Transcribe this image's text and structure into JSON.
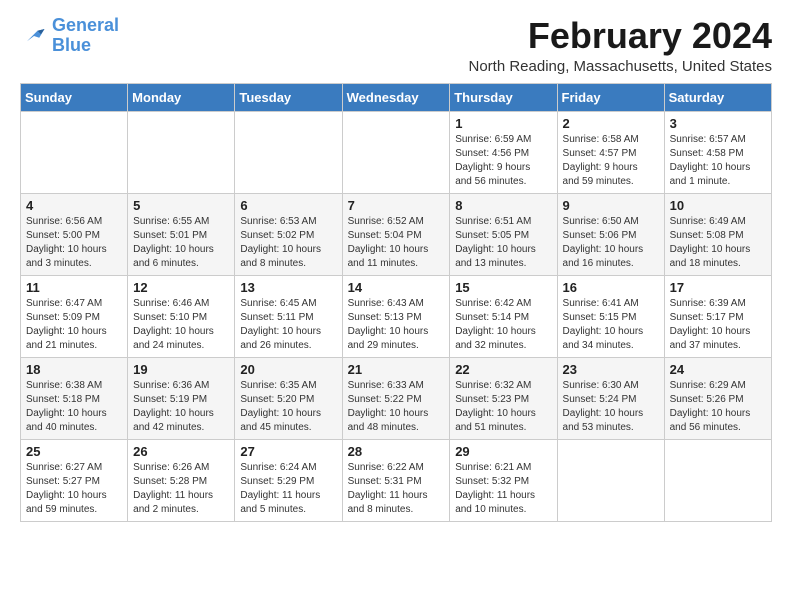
{
  "logo": {
    "line1": "General",
    "line2": "Blue"
  },
  "title": "February 2024",
  "location": "North Reading, Massachusetts, United States",
  "days_of_week": [
    "Sunday",
    "Monday",
    "Tuesday",
    "Wednesday",
    "Thursday",
    "Friday",
    "Saturday"
  ],
  "weeks": [
    [
      {
        "day": "",
        "info": ""
      },
      {
        "day": "",
        "info": ""
      },
      {
        "day": "",
        "info": ""
      },
      {
        "day": "",
        "info": ""
      },
      {
        "day": "1",
        "info": "Sunrise: 6:59 AM\nSunset: 4:56 PM\nDaylight: 9 hours\nand 56 minutes."
      },
      {
        "day": "2",
        "info": "Sunrise: 6:58 AM\nSunset: 4:57 PM\nDaylight: 9 hours\nand 59 minutes."
      },
      {
        "day": "3",
        "info": "Sunrise: 6:57 AM\nSunset: 4:58 PM\nDaylight: 10 hours\nand 1 minute."
      }
    ],
    [
      {
        "day": "4",
        "info": "Sunrise: 6:56 AM\nSunset: 5:00 PM\nDaylight: 10 hours\nand 3 minutes."
      },
      {
        "day": "5",
        "info": "Sunrise: 6:55 AM\nSunset: 5:01 PM\nDaylight: 10 hours\nand 6 minutes."
      },
      {
        "day": "6",
        "info": "Sunrise: 6:53 AM\nSunset: 5:02 PM\nDaylight: 10 hours\nand 8 minutes."
      },
      {
        "day": "7",
        "info": "Sunrise: 6:52 AM\nSunset: 5:04 PM\nDaylight: 10 hours\nand 11 minutes."
      },
      {
        "day": "8",
        "info": "Sunrise: 6:51 AM\nSunset: 5:05 PM\nDaylight: 10 hours\nand 13 minutes."
      },
      {
        "day": "9",
        "info": "Sunrise: 6:50 AM\nSunset: 5:06 PM\nDaylight: 10 hours\nand 16 minutes."
      },
      {
        "day": "10",
        "info": "Sunrise: 6:49 AM\nSunset: 5:08 PM\nDaylight: 10 hours\nand 18 minutes."
      }
    ],
    [
      {
        "day": "11",
        "info": "Sunrise: 6:47 AM\nSunset: 5:09 PM\nDaylight: 10 hours\nand 21 minutes."
      },
      {
        "day": "12",
        "info": "Sunrise: 6:46 AM\nSunset: 5:10 PM\nDaylight: 10 hours\nand 24 minutes."
      },
      {
        "day": "13",
        "info": "Sunrise: 6:45 AM\nSunset: 5:11 PM\nDaylight: 10 hours\nand 26 minutes."
      },
      {
        "day": "14",
        "info": "Sunrise: 6:43 AM\nSunset: 5:13 PM\nDaylight: 10 hours\nand 29 minutes."
      },
      {
        "day": "15",
        "info": "Sunrise: 6:42 AM\nSunset: 5:14 PM\nDaylight: 10 hours\nand 32 minutes."
      },
      {
        "day": "16",
        "info": "Sunrise: 6:41 AM\nSunset: 5:15 PM\nDaylight: 10 hours\nand 34 minutes."
      },
      {
        "day": "17",
        "info": "Sunrise: 6:39 AM\nSunset: 5:17 PM\nDaylight: 10 hours\nand 37 minutes."
      }
    ],
    [
      {
        "day": "18",
        "info": "Sunrise: 6:38 AM\nSunset: 5:18 PM\nDaylight: 10 hours\nand 40 minutes."
      },
      {
        "day": "19",
        "info": "Sunrise: 6:36 AM\nSunset: 5:19 PM\nDaylight: 10 hours\nand 42 minutes."
      },
      {
        "day": "20",
        "info": "Sunrise: 6:35 AM\nSunset: 5:20 PM\nDaylight: 10 hours\nand 45 minutes."
      },
      {
        "day": "21",
        "info": "Sunrise: 6:33 AM\nSunset: 5:22 PM\nDaylight: 10 hours\nand 48 minutes."
      },
      {
        "day": "22",
        "info": "Sunrise: 6:32 AM\nSunset: 5:23 PM\nDaylight: 10 hours\nand 51 minutes."
      },
      {
        "day": "23",
        "info": "Sunrise: 6:30 AM\nSunset: 5:24 PM\nDaylight: 10 hours\nand 53 minutes."
      },
      {
        "day": "24",
        "info": "Sunrise: 6:29 AM\nSunset: 5:26 PM\nDaylight: 10 hours\nand 56 minutes."
      }
    ],
    [
      {
        "day": "25",
        "info": "Sunrise: 6:27 AM\nSunset: 5:27 PM\nDaylight: 10 hours\nand 59 minutes."
      },
      {
        "day": "26",
        "info": "Sunrise: 6:26 AM\nSunset: 5:28 PM\nDaylight: 11 hours\nand 2 minutes."
      },
      {
        "day": "27",
        "info": "Sunrise: 6:24 AM\nSunset: 5:29 PM\nDaylight: 11 hours\nand 5 minutes."
      },
      {
        "day": "28",
        "info": "Sunrise: 6:22 AM\nSunset: 5:31 PM\nDaylight: 11 hours\nand 8 minutes."
      },
      {
        "day": "29",
        "info": "Sunrise: 6:21 AM\nSunset: 5:32 PM\nDaylight: 11 hours\nand 10 minutes."
      },
      {
        "day": "",
        "info": ""
      },
      {
        "day": "",
        "info": ""
      }
    ]
  ]
}
